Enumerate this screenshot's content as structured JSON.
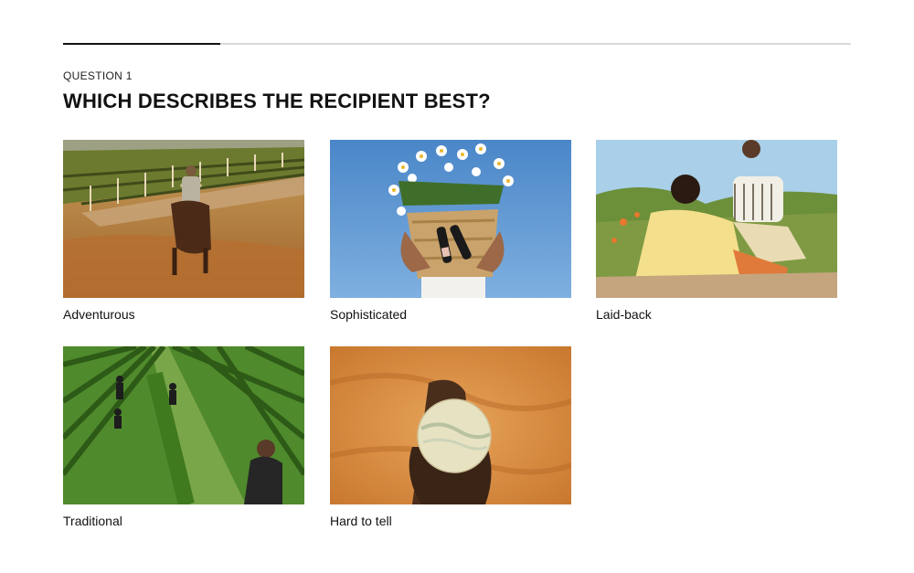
{
  "progress": {
    "value": 0.2
  },
  "question": {
    "eyebrow": "QUESTION 1",
    "title": "WHICH DESCRIBES THE RECIPIENT BEST?"
  },
  "options": [
    {
      "label": "Adventurous"
    },
    {
      "label": "Sophisticated"
    },
    {
      "label": "Laid-back"
    },
    {
      "label": "Traditional"
    },
    {
      "label": "Hard to tell"
    }
  ]
}
